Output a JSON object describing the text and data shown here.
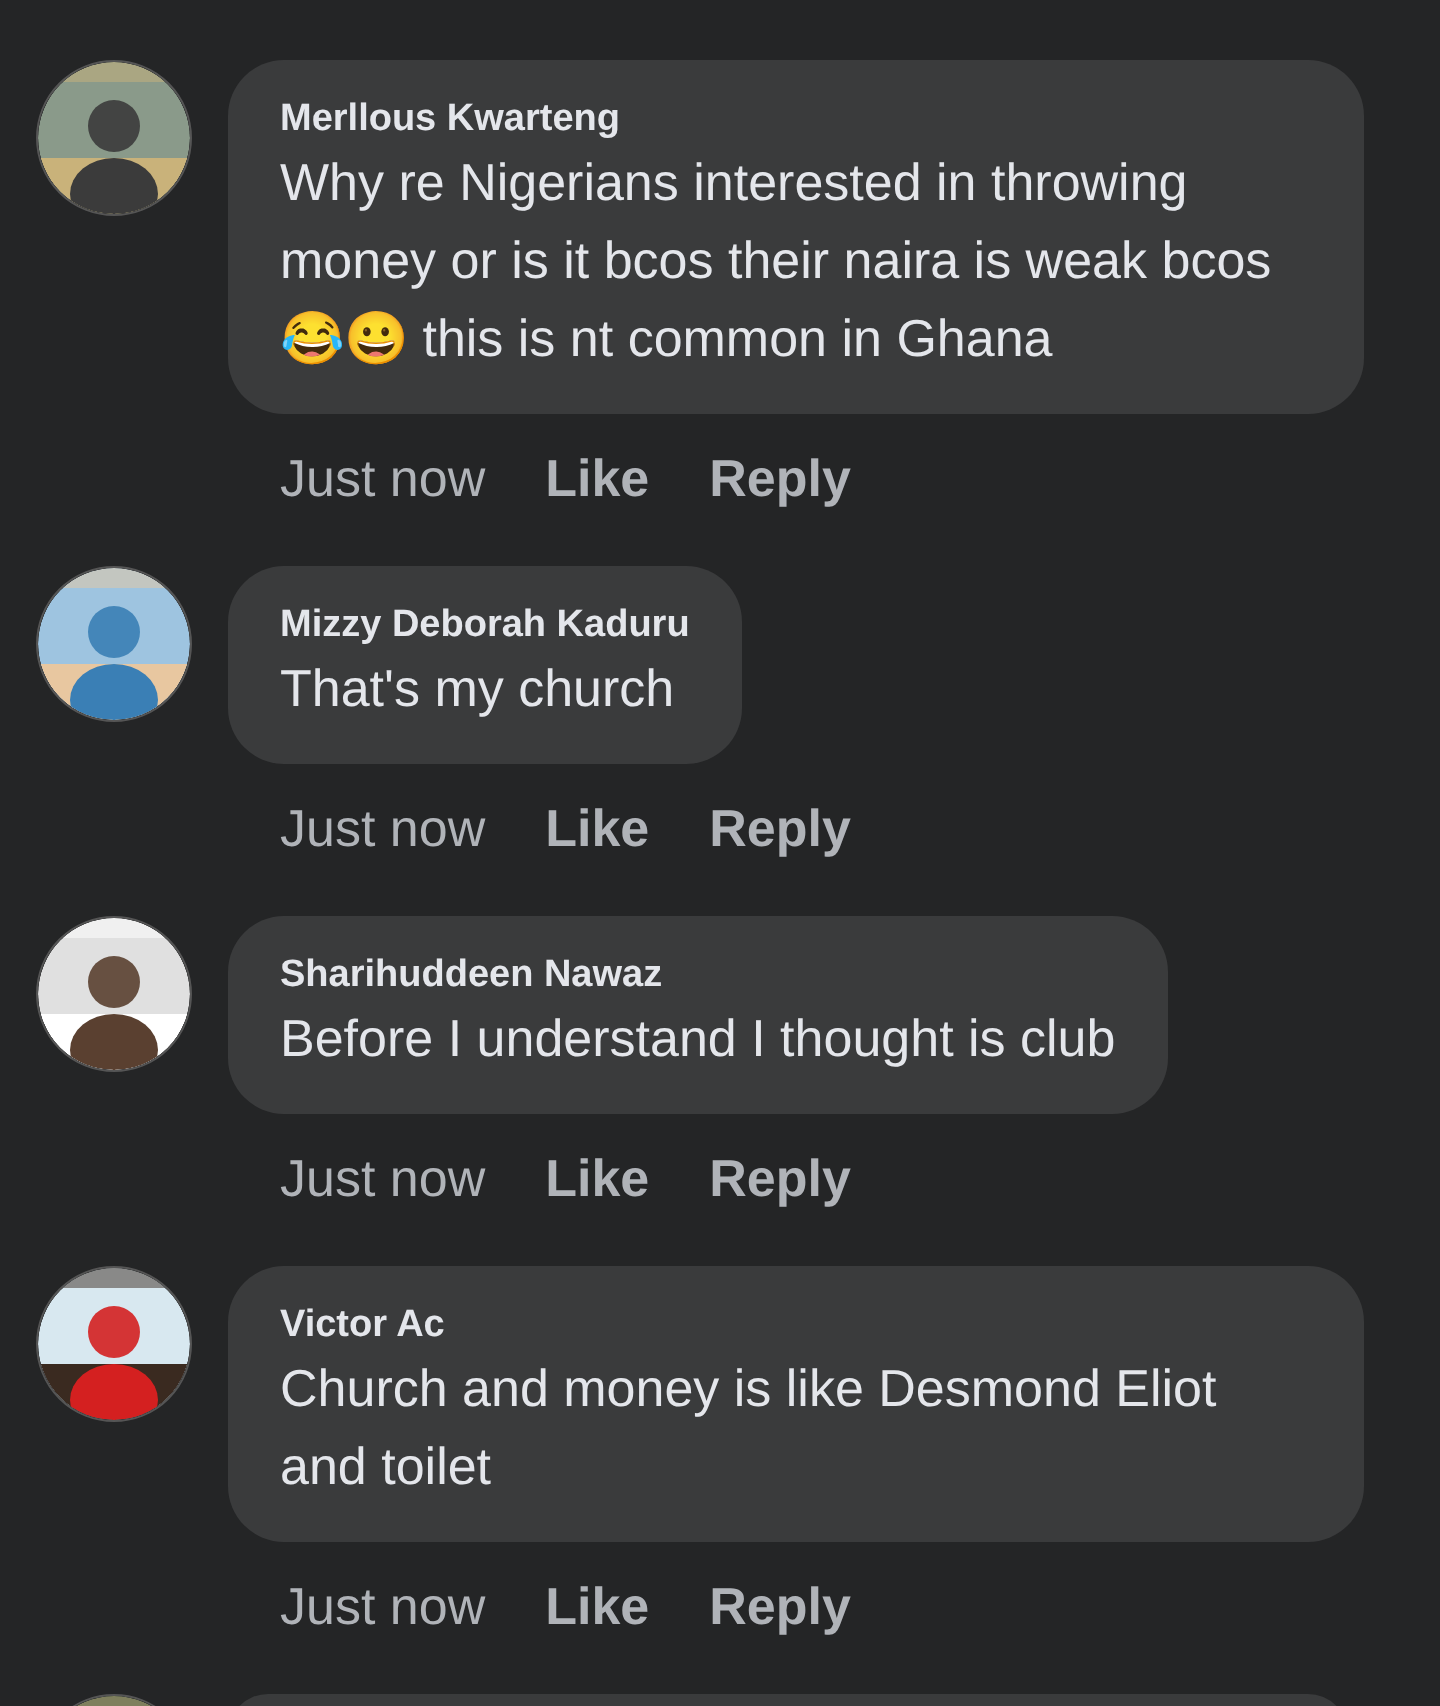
{
  "comments": [
    {
      "kind": "full",
      "name": "Merllous Kwarteng",
      "text": "Why re Nigerians interested in throwing money or is it bcos their naira is weak bcos😂😀 this is nt common in Ghana",
      "time": "Just now",
      "like": "Like",
      "reply": "Reply"
    },
    {
      "kind": "full",
      "name": "Mizzy Deborah Kaduru",
      "text": "That's my church",
      "time": "Just now",
      "like": "Like",
      "reply": "Reply"
    },
    {
      "kind": "full",
      "name": "Sharihuddeen Nawaz",
      "text": "Before I understand I thought is club",
      "time": "Just now",
      "like": "Like",
      "reply": "Reply"
    },
    {
      "kind": "full",
      "name": "Victor Ac",
      "text": "Church and money is like Desmond Eliot and toilet",
      "time": "Just now",
      "like": "Like",
      "reply": "Reply"
    },
    {
      "kind": "partial"
    }
  ]
}
